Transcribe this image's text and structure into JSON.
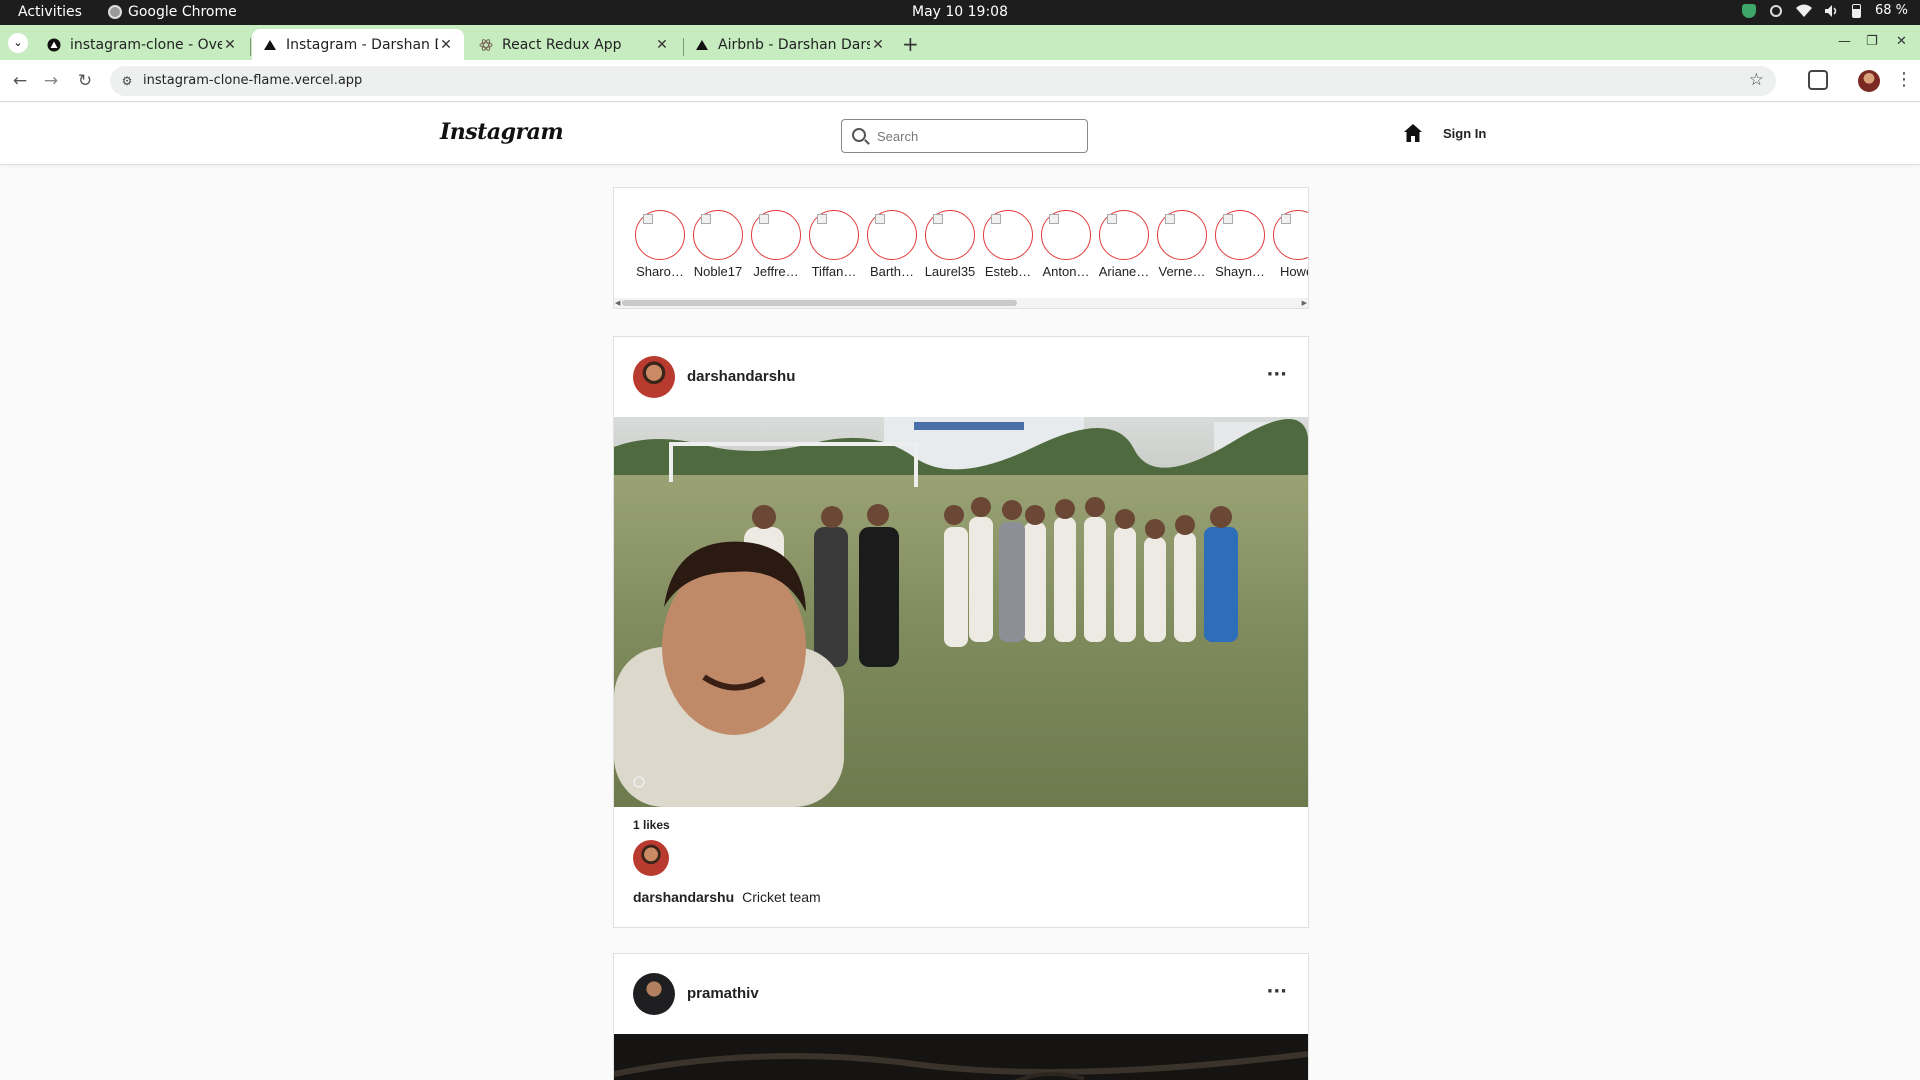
{
  "system_bar": {
    "activities": "Activities",
    "app_name": "Google Chrome",
    "clock": "May 10  19:08",
    "battery": "68 %"
  },
  "browser": {
    "tabs": [
      {
        "title": "instagram-clone - Overvi",
        "icon": "vercel-icon",
        "active": false
      },
      {
        "title": "Instagram - Darshan Dar",
        "icon": "vercel-icon",
        "active": true
      },
      {
        "title": "React Redux App",
        "icon": "react-icon",
        "active": false
      },
      {
        "title": "Airbnb - Darshan Darshu",
        "icon": "vercel-icon",
        "active": false
      }
    ],
    "url": "instagram-clone-flame.vercel.app"
  },
  "instagram": {
    "logo": "Instagram",
    "search_placeholder": "Search",
    "signin": "Sign In",
    "stories": [
      "Sharo…",
      "Noble17",
      "Jeffre…",
      "Tiffan…",
      "Barth…",
      "Laurel35",
      "Esteb…",
      "Anton…",
      "Ariane…",
      "Verne…",
      "Shayn…",
      "Howel"
    ],
    "posts": [
      {
        "username": "darshandarshu",
        "likes": "1 likes",
        "caption_user": "darshandarshu",
        "caption": "Cricket team"
      },
      {
        "username": "pramathiv"
      }
    ]
  },
  "colors": {
    "tabstrip": "#c6ecc0",
    "story_ring": "#e23b3b",
    "gnome_bar": "#1d1d1d"
  }
}
